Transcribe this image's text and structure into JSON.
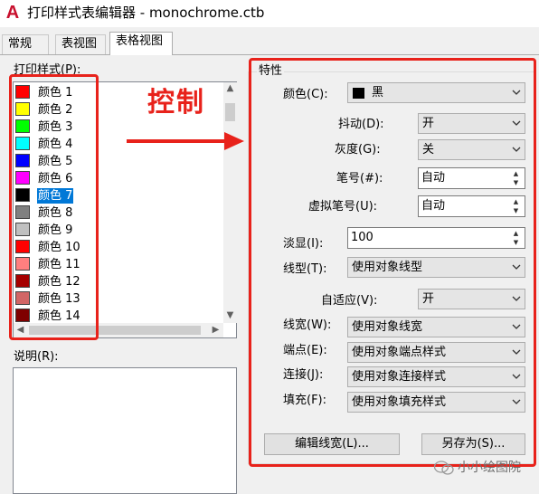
{
  "window": {
    "title": "打印样式表编辑器 - monochrome.ctb",
    "app_icon_letter": "A"
  },
  "tabs": [
    {
      "label": "常规"
    },
    {
      "label": "表视图"
    },
    {
      "label": "表格视图",
      "active": true
    }
  ],
  "styles_list": {
    "label": "打印样式(P):",
    "items": [
      {
        "label": "颜色 1",
        "color": "#ff0000"
      },
      {
        "label": "颜色 2",
        "color": "#ffff00"
      },
      {
        "label": "颜色 3",
        "color": "#00ff00"
      },
      {
        "label": "颜色 4",
        "color": "#00ffff"
      },
      {
        "label": "颜色 5",
        "color": "#0000ff"
      },
      {
        "label": "颜色 6",
        "color": "#ff00ff"
      },
      {
        "label": "颜色 7",
        "color": "#000000",
        "selected": true
      },
      {
        "label": "颜色 8",
        "color": "#808080"
      },
      {
        "label": "颜色 9",
        "color": "#c0c0c0"
      },
      {
        "label": "颜色 10",
        "color": "#ff0000"
      },
      {
        "label": "颜色 11",
        "color": "#ff7f7f"
      },
      {
        "label": "颜色 12",
        "color": "#a50000"
      },
      {
        "label": "颜色 13",
        "color": "#d26666"
      },
      {
        "label": "颜色 14",
        "color": "#7f0000"
      }
    ]
  },
  "description": {
    "label": "说明(R):"
  },
  "annotation": {
    "text": "控制",
    "color": "#e8221b"
  },
  "properties": {
    "group_label": "特性",
    "color": {
      "label": "颜色(C):",
      "value": "黑",
      "swatch": "#000000"
    },
    "dither": {
      "label": "抖动(D):",
      "value": "开"
    },
    "grayscale": {
      "label": "灰度(G):",
      "value": "关"
    },
    "pen": {
      "label": "笔号(#):",
      "value": "自动"
    },
    "virtual_pen": {
      "label": "虚拟笔号(U):",
      "value": "自动"
    },
    "screening": {
      "label": "淡显(I):",
      "value": "100"
    },
    "linetype": {
      "label": "线型(T):",
      "value": "使用对象线型"
    },
    "adaptive": {
      "label": "自适应(V):",
      "value": "开"
    },
    "lineweight": {
      "label": "线宽(W):",
      "value": "使用对象线宽"
    },
    "line_end": {
      "label": "端点(E):",
      "value": "使用对象端点样式"
    },
    "line_join": {
      "label": "连接(J):",
      "value": "使用对象连接样式"
    },
    "fill": {
      "label": "填充(F):",
      "value": "使用对象填充样式"
    },
    "edit_lineweights_button": "编辑线宽(L)...",
    "save_as_button": "另存为(S)..."
  },
  "watermark": {
    "text": "小小绘图院"
  }
}
